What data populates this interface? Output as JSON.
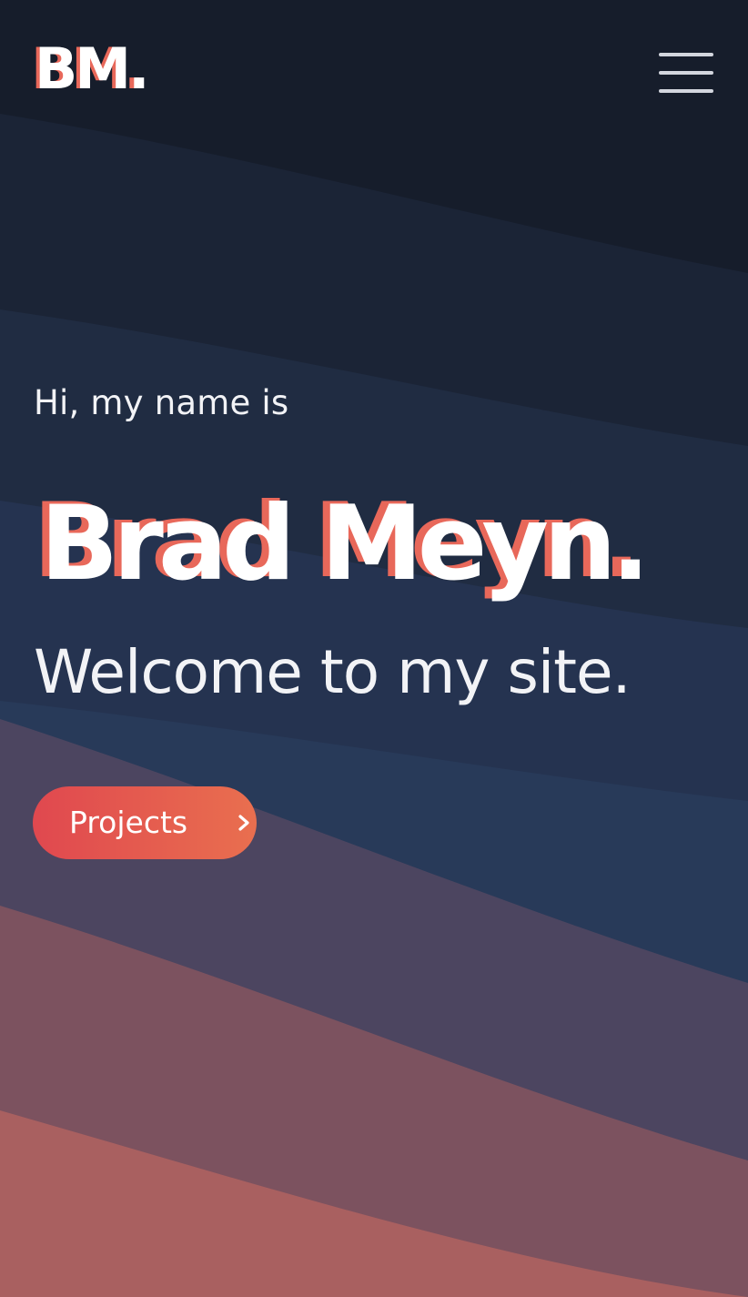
{
  "header": {
    "logo": {
      "letters": "BM",
      "dot": "."
    },
    "menu_icon": "hamburger-menu-icon"
  },
  "hero": {
    "intro": "Hi, my name is",
    "name": "Brad Meyn",
    "name_dot": ".",
    "tagline": "Welcome to my site.",
    "cta": {
      "label": "Projects",
      "icon": "chevron-right-icon"
    }
  },
  "colors": {
    "accent": "#e8685a",
    "button_start": "#e0484f",
    "button_end": "#e96f4f",
    "text": "#ffffff",
    "background_top": "#161d2b",
    "background_mid": "#283a59",
    "background_bottom": "#a96060"
  }
}
